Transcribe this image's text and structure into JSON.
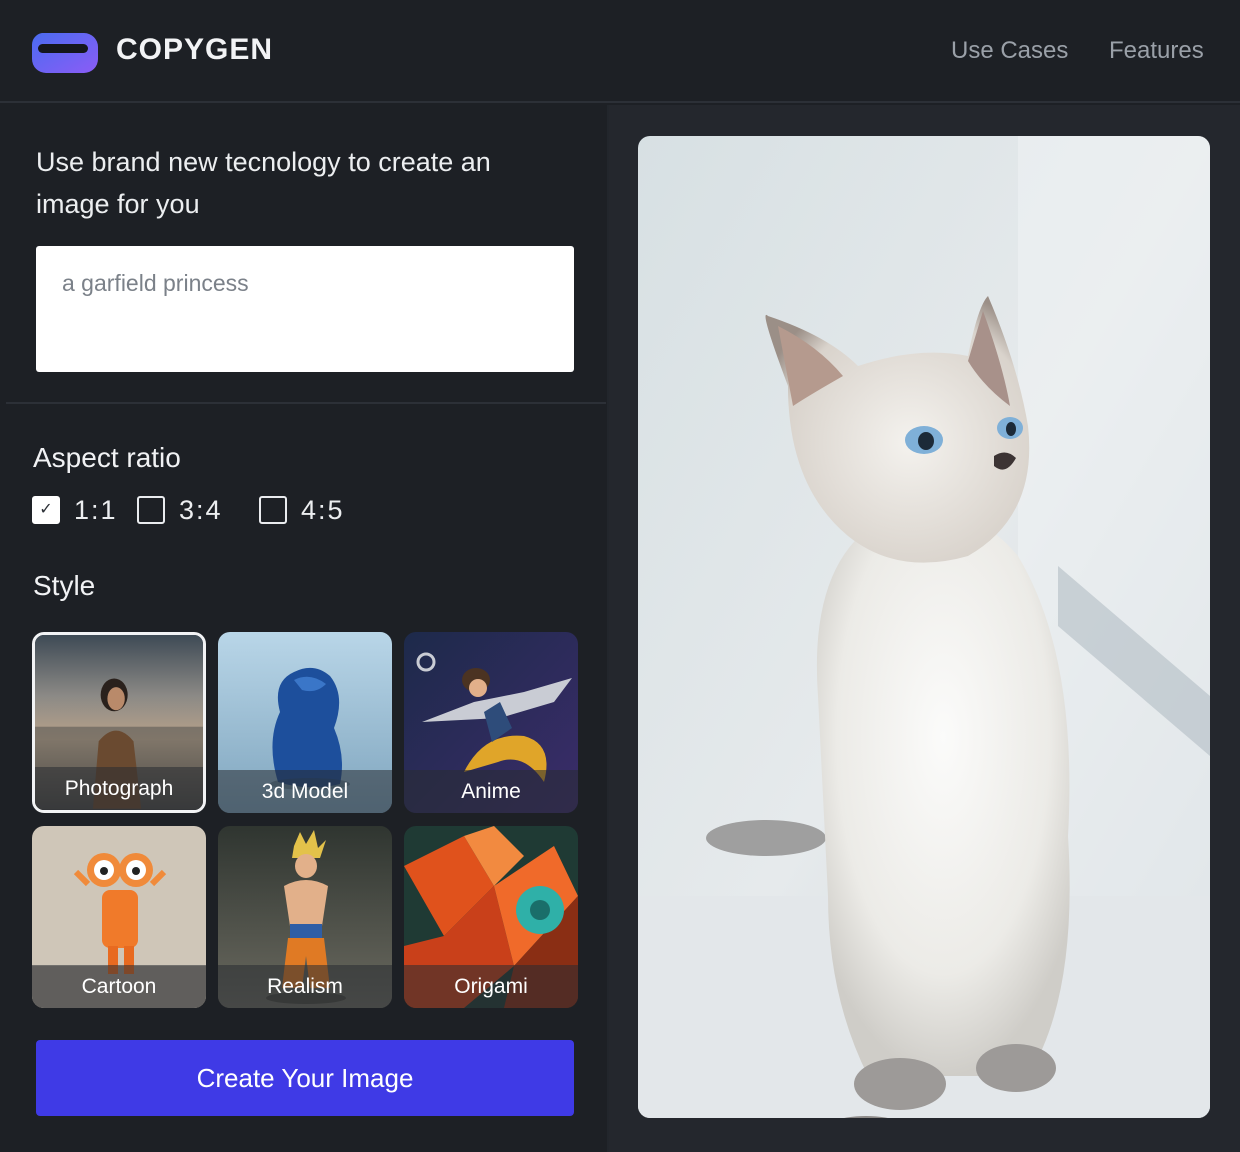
{
  "brand": {
    "name": "COPYGEN",
    "logo_icon": "logo-pill-icon"
  },
  "nav": [
    {
      "label": "Use Cases"
    },
    {
      "label": "Features"
    }
  ],
  "intro_text": "Use brand new tecnology to create an image for you",
  "prompt": {
    "value": "",
    "placeholder": "a garfield princess"
  },
  "aspect_ratio": {
    "title": "Aspect ratio",
    "options": [
      {
        "label": "1:1",
        "checked": true
      },
      {
        "label": "3:4",
        "checked": false
      },
      {
        "label": "4:5",
        "checked": false
      }
    ]
  },
  "style": {
    "title": "Style",
    "selected": "Photograph",
    "options": [
      {
        "label": "Photograph"
      },
      {
        "label": "3d Model"
      },
      {
        "label": "Anime"
      },
      {
        "label": "Cartoon"
      },
      {
        "label": "Realism"
      },
      {
        "label": "Origami"
      }
    ]
  },
  "create_button": {
    "label": "Create Your Image"
  },
  "preview": {
    "subject": "white-kitten-photo"
  },
  "colors": {
    "background": "#1d2025",
    "panel": "#24272d",
    "accent": "#3f3ae6",
    "text": "#eceef0",
    "muted": "#9aa0a8"
  }
}
